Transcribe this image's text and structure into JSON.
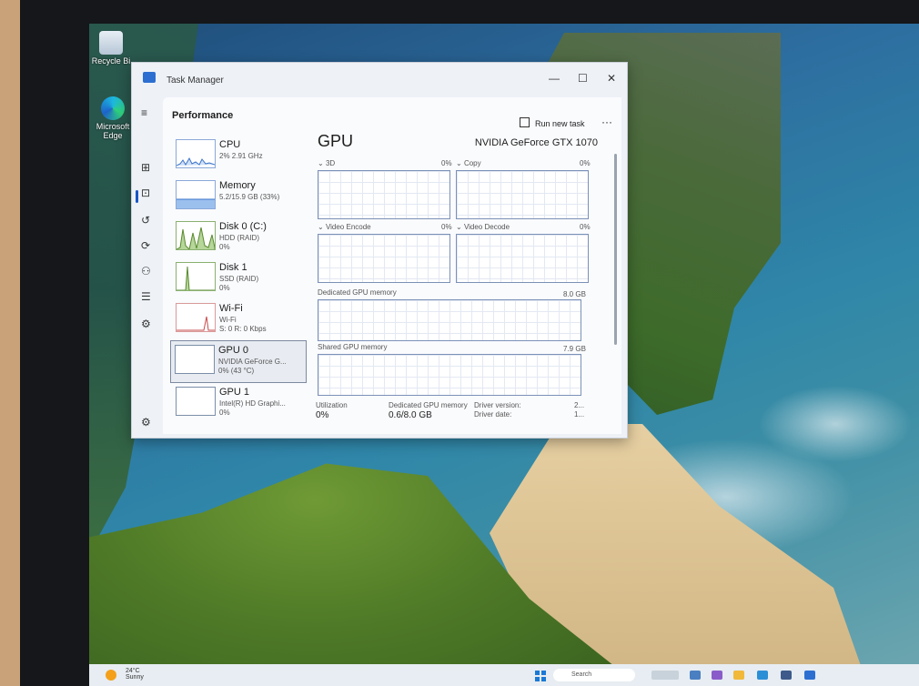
{
  "desktop": {
    "icons": [
      {
        "label": "Recycle Bi",
        "icon": "recycle-bin-icon"
      },
      {
        "label": "Microsoft Edge",
        "icon": "edge-icon"
      }
    ]
  },
  "window": {
    "title": "Task Manager",
    "controls": {
      "minimize": "—",
      "maximize": "☐",
      "close": "✕"
    }
  },
  "nav": [
    {
      "name": "menu-icon",
      "glyph": "≡"
    },
    {
      "name": "processes-icon",
      "glyph": "⊞"
    },
    {
      "name": "performance-icon",
      "glyph": "⊡"
    },
    {
      "name": "app-history-icon",
      "glyph": "↺"
    },
    {
      "name": "startup-apps-icon",
      "glyph": "⟳"
    },
    {
      "name": "users-icon",
      "glyph": "⚇"
    },
    {
      "name": "details-icon",
      "glyph": "☰"
    },
    {
      "name": "services-icon",
      "glyph": "⚙"
    }
  ],
  "settings_glyph": "⚙",
  "header": {
    "section": "Performance",
    "run_new_task": "Run new task",
    "more": "···"
  },
  "perf_items": [
    {
      "name": "CPU",
      "sub": "2% 2.91 GHz",
      "sub2": ""
    },
    {
      "name": "Memory",
      "sub": "5.2/15.9 GB (33%)",
      "sub2": ""
    },
    {
      "name": "Disk 0 (C:)",
      "sub": "HDD (RAID)",
      "sub2": "0%"
    },
    {
      "name": "Disk 1",
      "sub": "SSD (RAID)",
      "sub2": "0%"
    },
    {
      "name": "Wi-Fi",
      "sub": "Wi-Fi",
      "sub2": "S: 0 R: 0 Kbps"
    },
    {
      "name": "GPU 0",
      "sub": "NVIDIA GeForce G...",
      "sub2": "0% (43 °C)"
    },
    {
      "name": "GPU 1",
      "sub": "Intel(R) HD Graphi...",
      "sub2": "0%"
    }
  ],
  "gpu": {
    "title": "GPU",
    "model": "NVIDIA GeForce GTX 1070",
    "engines": [
      {
        "label": "3D",
        "value": "0%"
      },
      {
        "label": "Copy",
        "value": "0%"
      },
      {
        "label": "Video Encode",
        "value": "0%"
      },
      {
        "label": "Video Decode",
        "value": "0%"
      }
    ],
    "dedicated_memory": {
      "label": "Dedicated GPU memory",
      "max": "8.0 GB"
    },
    "shared_memory": {
      "label": "Shared GPU memory",
      "max": "7.9 GB"
    },
    "stats": {
      "utilization_label": "Utilization",
      "utilization_value": "0%",
      "dedicated_label": "Dedicated GPU memory",
      "dedicated_value": "0.6/8.0 GB",
      "driver_version_label": "Driver version:",
      "driver_version_value": "2...",
      "driver_date_label": "Driver date:",
      "driver_date_value": "1..."
    }
  },
  "taskbar": {
    "temperature": "24°C",
    "condition": "Sunny",
    "search_placeholder": "Search"
  }
}
